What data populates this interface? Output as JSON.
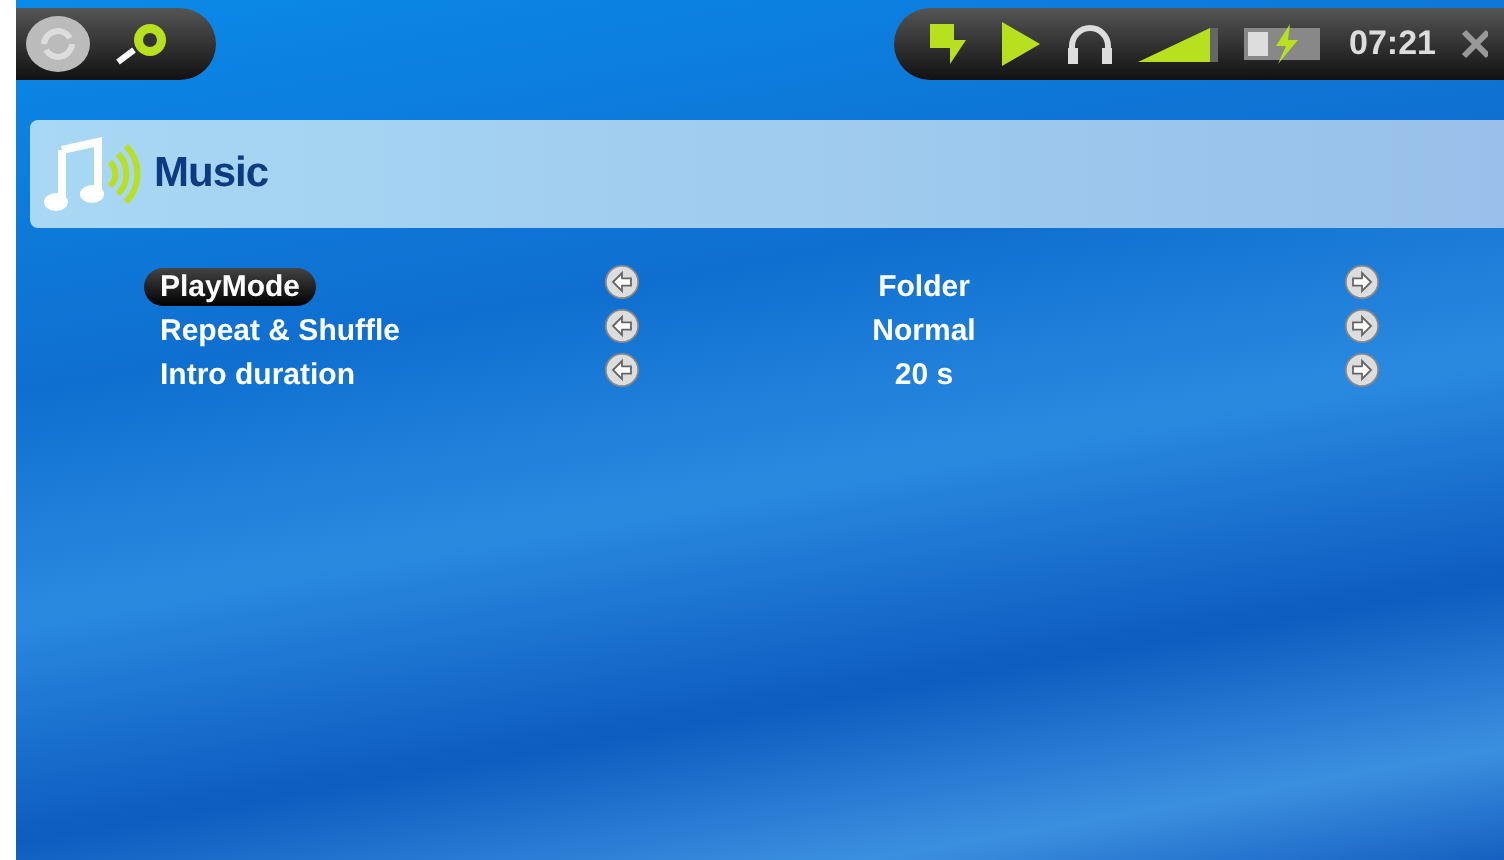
{
  "status_bar": {
    "time": "07:21"
  },
  "header": {
    "title": "Music"
  },
  "settings": [
    {
      "label": "PlayMode",
      "value": "Folder",
      "selected": true
    },
    {
      "label": "Repeat & Shuffle",
      "value": "Normal",
      "selected": false
    },
    {
      "label": "Intro duration",
      "value": "20 s",
      "selected": false
    }
  ]
}
